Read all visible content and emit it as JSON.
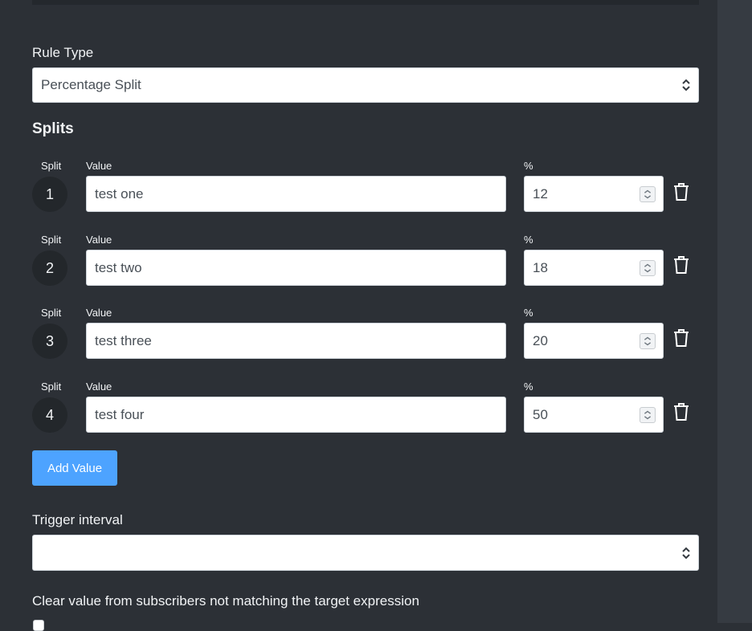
{
  "rule_type": {
    "label": "Rule Type",
    "value": "Percentage Split"
  },
  "splits": {
    "heading": "Splits",
    "split_label": "Split",
    "value_label": "Value",
    "percent_label": "%",
    "rows": [
      {
        "number": "1",
        "value": "test one",
        "percent": "12"
      },
      {
        "number": "2",
        "value": "test two",
        "percent": "18"
      },
      {
        "number": "3",
        "value": "test three",
        "percent": "20"
      },
      {
        "number": "4",
        "value": "test four",
        "percent": "50"
      }
    ]
  },
  "add_value_label": "Add Value",
  "trigger_interval": {
    "label": "Trigger interval",
    "value": ""
  },
  "clear_value": {
    "label": "Clear value from subscribers not matching the target expression",
    "checked": false
  },
  "colors": {
    "background": "#2c3036",
    "accent": "#4da3ff"
  }
}
